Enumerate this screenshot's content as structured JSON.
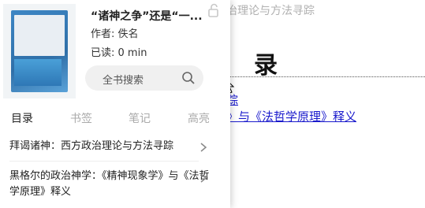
{
  "document": {
    "running_header": "治理论与方法寻踪",
    "heading": "录",
    "links": [
      "踪",
      "》与《法哲学原理》释义"
    ]
  },
  "panel": {
    "book": {
      "title": "“诸神之争”还是“一...",
      "author": "作者: 佚名",
      "read_time": "已读: 0 min"
    },
    "search": {
      "label": "全书搜索"
    },
    "tabs": [
      "目录",
      "书签",
      "笔记",
      "高亮"
    ],
    "active_tab": "目录",
    "toc": [
      {
        "title": "拜谒诸神：西方政治理论与方法寻踪"
      },
      {
        "title": "黑格尔的政治神学：《精神现象学》与《法哲学原理》释义"
      }
    ]
  }
}
